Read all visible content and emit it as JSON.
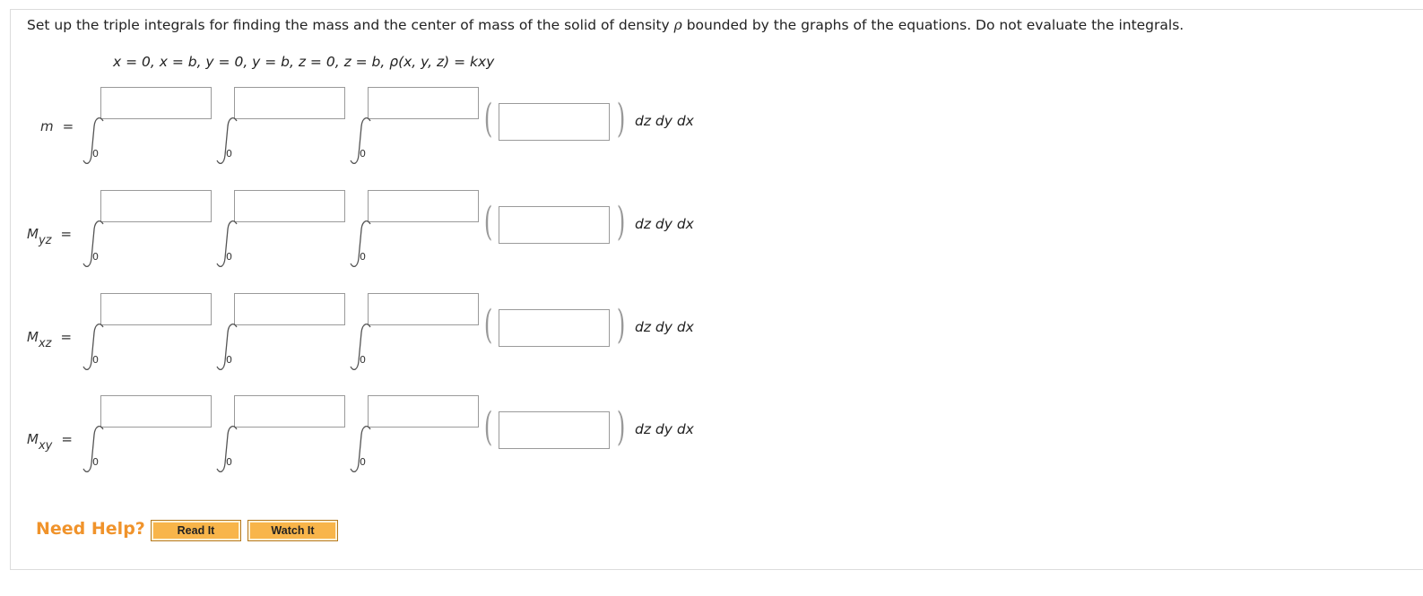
{
  "question": {
    "text_before_rho": "Set up the triple integrals for finding the mass and the center of mass of the solid of density ",
    "rho": "ρ",
    "text_after_rho": " bounded by the graphs of the equations. Do not evaluate the integrals."
  },
  "given": {
    "equations": "x = 0, x = b, y = 0, y = b, z = 0, z = b,  ρ(x, y, z) = kxy"
  },
  "rows": [
    {
      "symbol": "m",
      "sub": "",
      "eq": "=",
      "lower": [
        "0",
        "0",
        "0"
      ],
      "upper": [
        "",
        "",
        ""
      ],
      "integrand": "",
      "differential": "dz dy dx"
    },
    {
      "symbol": "M",
      "sub": "yz",
      "eq": "=",
      "lower": [
        "0",
        "0",
        "0"
      ],
      "upper": [
        "",
        "",
        ""
      ],
      "integrand": "",
      "differential": "dz dy dx"
    },
    {
      "symbol": "M",
      "sub": "xz",
      "eq": "=",
      "lower": [
        "0",
        "0",
        "0"
      ],
      "upper": [
        "",
        "",
        ""
      ],
      "integrand": "",
      "differential": "dz dy dx"
    },
    {
      "symbol": "M",
      "sub": "xy",
      "eq": "=",
      "lower": [
        "0",
        "0",
        "0"
      ],
      "upper": [
        "",
        "",
        ""
      ],
      "integrand": "",
      "differential": "dz dy dx"
    }
  ],
  "help": {
    "label": "Need Help?",
    "read_it": "Read It",
    "watch_it": "Watch It"
  },
  "colors": {
    "help_text": "#f0932b",
    "button_bg": "#f8b54a",
    "input_border": "#9a9a9a"
  }
}
